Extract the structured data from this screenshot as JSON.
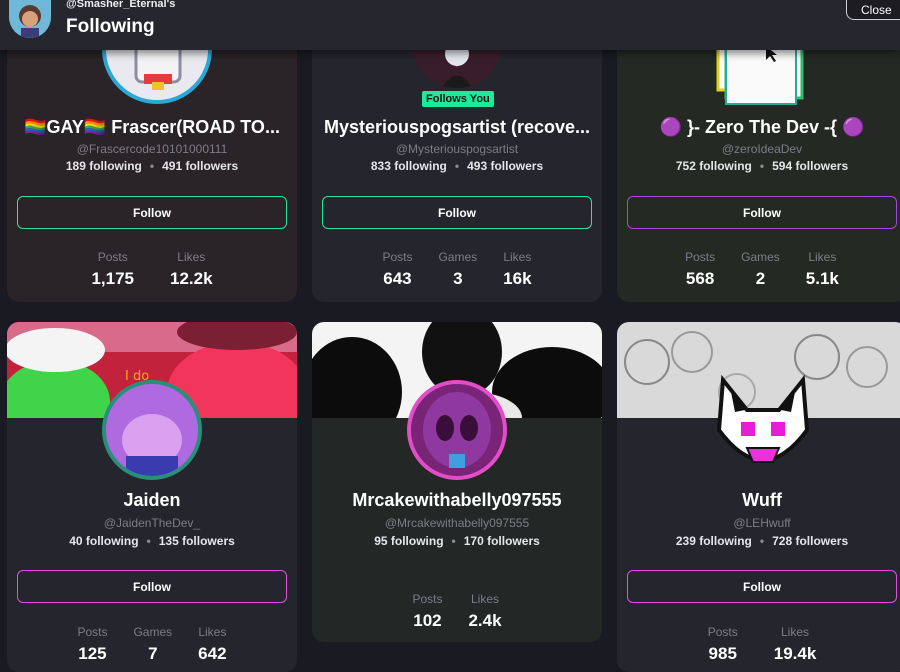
{
  "header": {
    "owner": "@Smasher_Eternal's",
    "title": "Following",
    "close_label": "Close"
  },
  "cards": [
    {
      "name": "🏳️‍🌈GAY🏳️‍🌈 Frascer(ROAD TO...",
      "handle": "@Frascercode10101000111",
      "following": "189 following",
      "followers": "491 followers",
      "follow_label": "Follow",
      "stats": [
        {
          "label": "Posts",
          "value": "1,175"
        },
        {
          "label": "Likes",
          "value": "12.2k"
        }
      ]
    },
    {
      "name": "Mysteriouspogsartist (recove...",
      "handle": "@Mysteriouspogsartist",
      "following": "833 following",
      "followers": "493 followers",
      "follow_label": "Follow",
      "badge": "Follows You",
      "stats": [
        {
          "label": "Posts",
          "value": "643"
        },
        {
          "label": "Games",
          "value": "3"
        },
        {
          "label": "Likes",
          "value": "16k"
        }
      ]
    },
    {
      "name": "🟣 }- Zero The Dev -{ 🟣",
      "handle": "@zeroIdeaDev",
      "following": "752 following",
      "followers": "594 followers",
      "follow_label": "Follow",
      "stats": [
        {
          "label": "Posts",
          "value": "568"
        },
        {
          "label": "Games",
          "value": "2"
        },
        {
          "label": "Likes",
          "value": "5.1k"
        }
      ]
    },
    {
      "name": "Jaiden",
      "handle": "@JaidenTheDev_",
      "following": "40 following",
      "followers": "135 followers",
      "follow_label": "Follow",
      "stats": [
        {
          "label": "Posts",
          "value": "125"
        },
        {
          "label": "Games",
          "value": "7"
        },
        {
          "label": "Likes",
          "value": "642"
        }
      ]
    },
    {
      "name": "Mrcakewithabelly097555",
      "handle": "@Mrcakewithabelly097555",
      "following": "95 following",
      "followers": "170 followers",
      "stats": [
        {
          "label": "Posts",
          "value": "102"
        },
        {
          "label": "Likes",
          "value": "2.4k"
        }
      ]
    },
    {
      "name": "Wuff",
      "handle": "@LEHwuff",
      "following": "239 following",
      "followers": "728 followers",
      "follow_label": "Follow",
      "stats": [
        {
          "label": "Posts",
          "value": "985"
        },
        {
          "label": "Likes",
          "value": "19.4k"
        }
      ]
    }
  ],
  "colors": {
    "accent_green": "#22e89a",
    "accent_pink": "#e24ee0",
    "accent_purple": "#a647d8"
  }
}
